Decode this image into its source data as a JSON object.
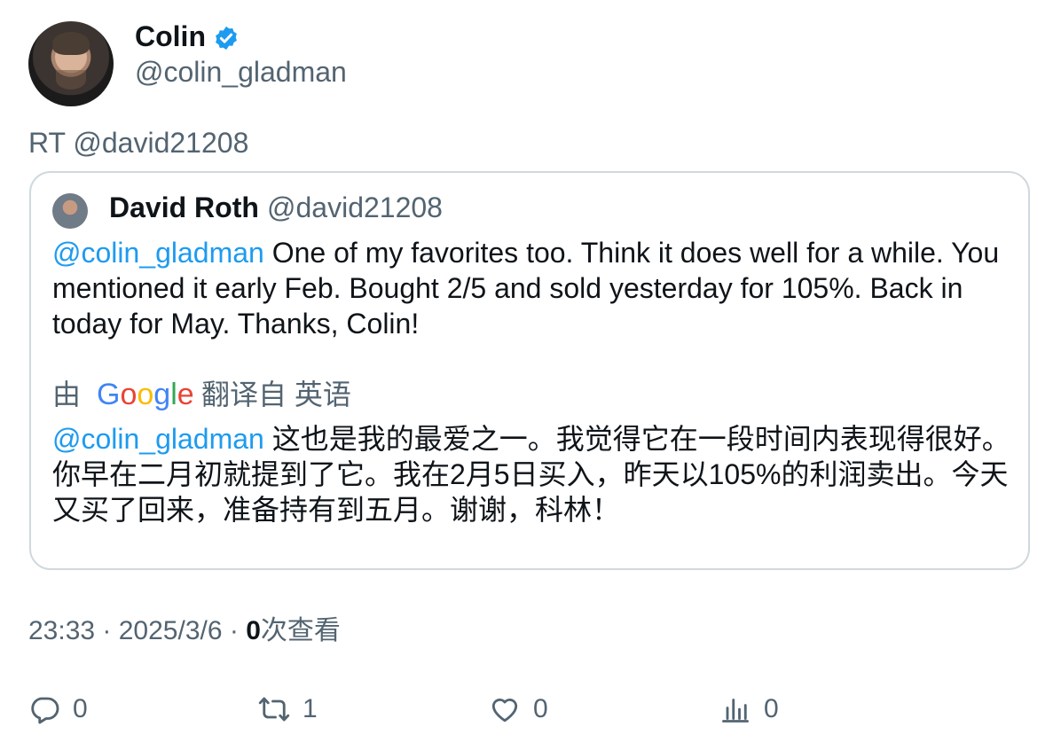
{
  "author": {
    "name": "Colin",
    "handle": "@colin_gladman"
  },
  "retweet_line": "RT @david21208",
  "quoted": {
    "name": "David Roth",
    "handle": "@david21208",
    "mention": "@colin_gladman",
    "text": " One of my favorites too. Think it does well for a while. You mentioned it early Feb. Bought 2/5 and sold yesterday for 105%. Back in today for May. Thanks, Colin!",
    "translation": {
      "by": "由",
      "provider": "Google",
      "from": "翻译自 英语",
      "mention": "@colin_gladman",
      "text": " 这也是我的最爱之一。我觉得它在一段时间内表现得很好。你早在二月初就提到了它。我在2月5日买入，昨天以105%的利润卖出。今天又买了回来，准备持有到五月。谢谢，科林！"
    }
  },
  "meta": {
    "time": "23:33",
    "date": "2025/3/6",
    "views_count": "0",
    "views_label": "次查看"
  },
  "actions": {
    "replies": "0",
    "retweets": "1",
    "likes": "0",
    "views": "0"
  },
  "colors": {
    "accent": "#1d9bf0",
    "secondary_text": "#536471",
    "border": "#cfd9de"
  }
}
